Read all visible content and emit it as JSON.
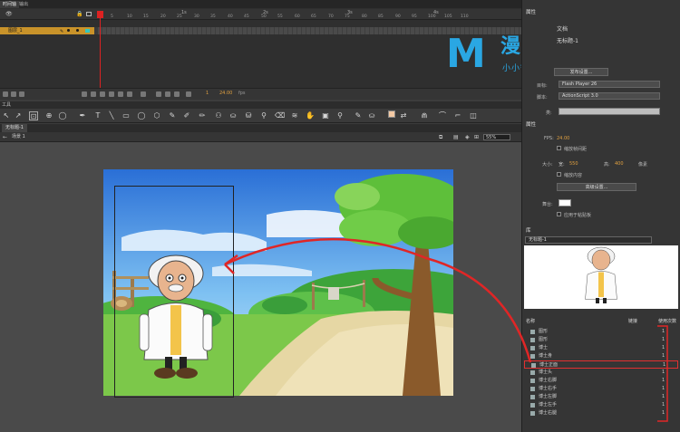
{
  "timeline": {
    "tabs": [
      "时间轴",
      "输出"
    ],
    "seconds": [
      "1s",
      "2s",
      "3s",
      "4s"
    ],
    "frames": [
      "1",
      "5",
      "10",
      "15",
      "20",
      "25",
      "30",
      "35",
      "40",
      "45",
      "50",
      "55",
      "60",
      "65",
      "70",
      "75",
      "80",
      "85",
      "90",
      "95",
      "100",
      "105",
      "110"
    ],
    "layer_name": "图层_1",
    "fps": "1",
    "time": "24.00",
    "frame_time": "fps"
  },
  "tools_label": "工具",
  "document": {
    "tab": "无标题-1",
    "scene": "场景 1",
    "zoom": "55%",
    "fill_color": "#f3c9a4"
  },
  "properties": {
    "panel_title": "属性",
    "doc_label": "文档",
    "doc_name": "无标题-1",
    "publish_settings_button": "发布设置...",
    "target_label": "目标:",
    "target_value": "Flash Player 26",
    "script_label": "脚本:",
    "script_value": "ActionScript 3.0",
    "class_label": "类:",
    "section_title": "属性",
    "fps_label": "FPS:",
    "fps_value": "24.00",
    "scale_spans_label": "缩放帧间距",
    "size_label": "大小:",
    "width_label": "宽:",
    "width_value": "550",
    "height_label": "高:",
    "height_value": "400",
    "unit": "像素",
    "scale_content_label": "缩放内容",
    "advanced_button": "高级设置...",
    "stage_label": "舞台:",
    "stage_color": "#ffffff",
    "apply_pasteboard_label": "应用于粘贴板"
  },
  "library": {
    "panel_title": "库",
    "doc_select": "无标题-1",
    "col_name": "名称",
    "col_link": "链接",
    "col_uses": "使用次数",
    "items": [
      {
        "name": "图形",
        "count": "1"
      },
      {
        "name": "图形",
        "count": "1"
      },
      {
        "name": "博士",
        "count": "1"
      },
      {
        "name": "博士身",
        "count": "1"
      },
      {
        "name": "博士正面",
        "count": "1"
      },
      {
        "name": "博士头",
        "count": "1"
      },
      {
        "name": "博士右脚",
        "count": "1"
      },
      {
        "name": "博士右手",
        "count": "1"
      },
      {
        "name": "博士左脚",
        "count": "1"
      },
      {
        "name": "博士左手",
        "count": "1"
      },
      {
        "name": "博士右腿",
        "count": "1"
      }
    ]
  },
  "watermark": {
    "letter": "M",
    "brand": "漫品购",
    "slogan": "小小智慧 大大品牌"
  }
}
